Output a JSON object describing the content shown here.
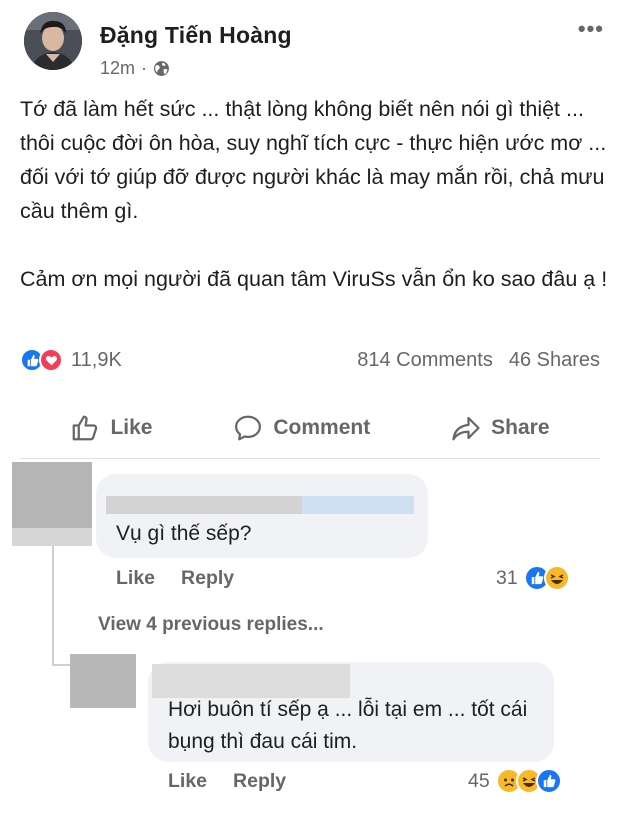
{
  "post": {
    "author": "Đặng Tiến Hoàng",
    "time": "12m",
    "privacy_icon": "globe-icon",
    "more_icon": "more-icon",
    "text": "Tớ đã làm hết sức ... thật lòng không biết nên nói gì thiệt ... thôi cuộc đời ôn hòa, suy nghĩ tích cực - thực hiện ước mơ ... đối với tớ giúp đỡ được người khác là may mắn rồi, chả mưu cầu thêm gì.\n\nCảm ơn mọi người đã quan tâm ViruSs vẫn ổn ko sao đâu ạ !"
  },
  "reactions": {
    "count": "11,9K",
    "icons": [
      "like-icon",
      "love-icon"
    ],
    "comments": "814 Comments",
    "shares": "46 Shares"
  },
  "actions": {
    "like": "Like",
    "comment": "Comment",
    "share": "Share"
  },
  "comments": [
    {
      "text": "Vụ gì thế sếp?",
      "like_label": "Like",
      "reply_label": "Reply",
      "reaction_count": "31",
      "reaction_icons": [
        "like-icon",
        "haha-icon"
      ]
    }
  ],
  "view_previous": "View 4 previous replies...",
  "reply": {
    "text": "Hơi buôn tí sếp ạ ... lỗi tại em ... tốt cái bụng thì đau cái tim.",
    "like_label": "Like",
    "reply_label": "Reply",
    "reaction_count": "45",
    "reaction_icons": [
      "sad-icon",
      "haha-icon",
      "like-icon"
    ]
  },
  "colors": {
    "like_blue": "#1877f2",
    "love_red": "#f33e58",
    "haha_yellow": "#f7b928",
    "secondary_text": "#65676b",
    "bubble_bg": "#f0f2f5"
  }
}
